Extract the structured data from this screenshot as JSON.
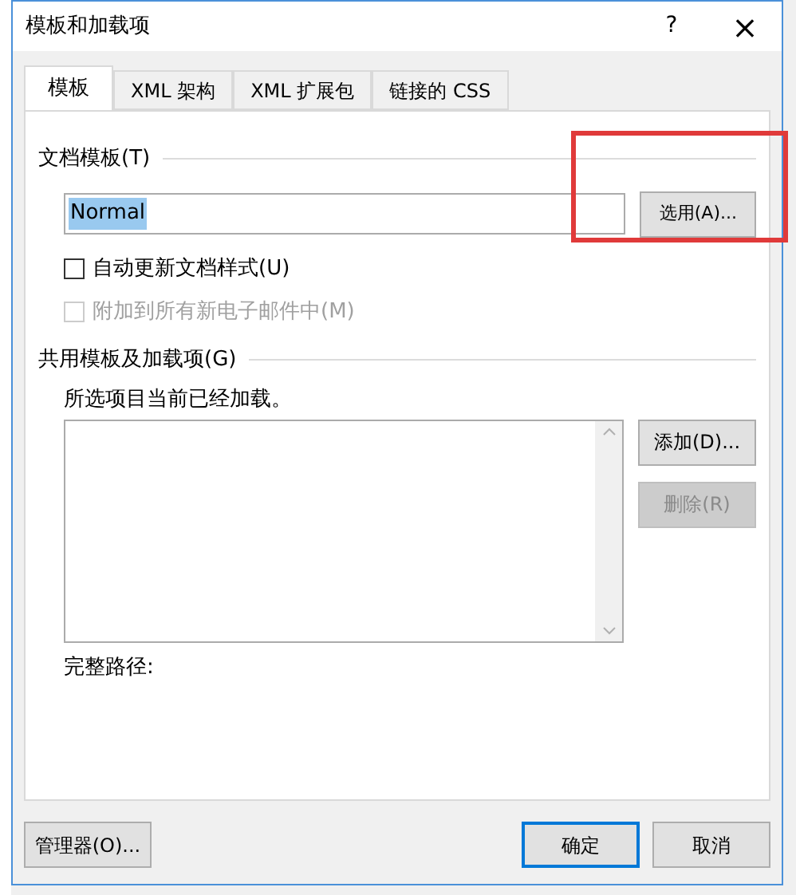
{
  "window": {
    "title": "模板和加载项",
    "help": "?",
    "close": "×"
  },
  "tabs": [
    {
      "label": "模板",
      "selected": true
    },
    {
      "label": "XML 架构",
      "selected": false
    },
    {
      "label": "XML 扩展包",
      "selected": false
    },
    {
      "label": "链接的 CSS",
      "selected": false
    }
  ],
  "document_template": {
    "heading": "文档模板(T)",
    "value": "Normal",
    "button": "选用(A)...",
    "highlighted": true
  },
  "options": [
    {
      "label": "自动更新文档样式(U)",
      "checked": false,
      "disabled": false
    },
    {
      "label": "附加到所有新电子邮件中(M)",
      "checked": false,
      "disabled": true
    }
  ],
  "global_templates": {
    "heading": "共用模板及加载项(G)",
    "caption": "所选项目当前已经加载。",
    "buttons": [
      {
        "label": "添加(D)...",
        "disabled": false
      },
      {
        "label": "删除(R)",
        "disabled": true
      }
    ],
    "full_path_label": "完整路径:"
  },
  "footer": {
    "organizer": "管理器(O)...",
    "ok": "确定",
    "cancel": "取消"
  }
}
